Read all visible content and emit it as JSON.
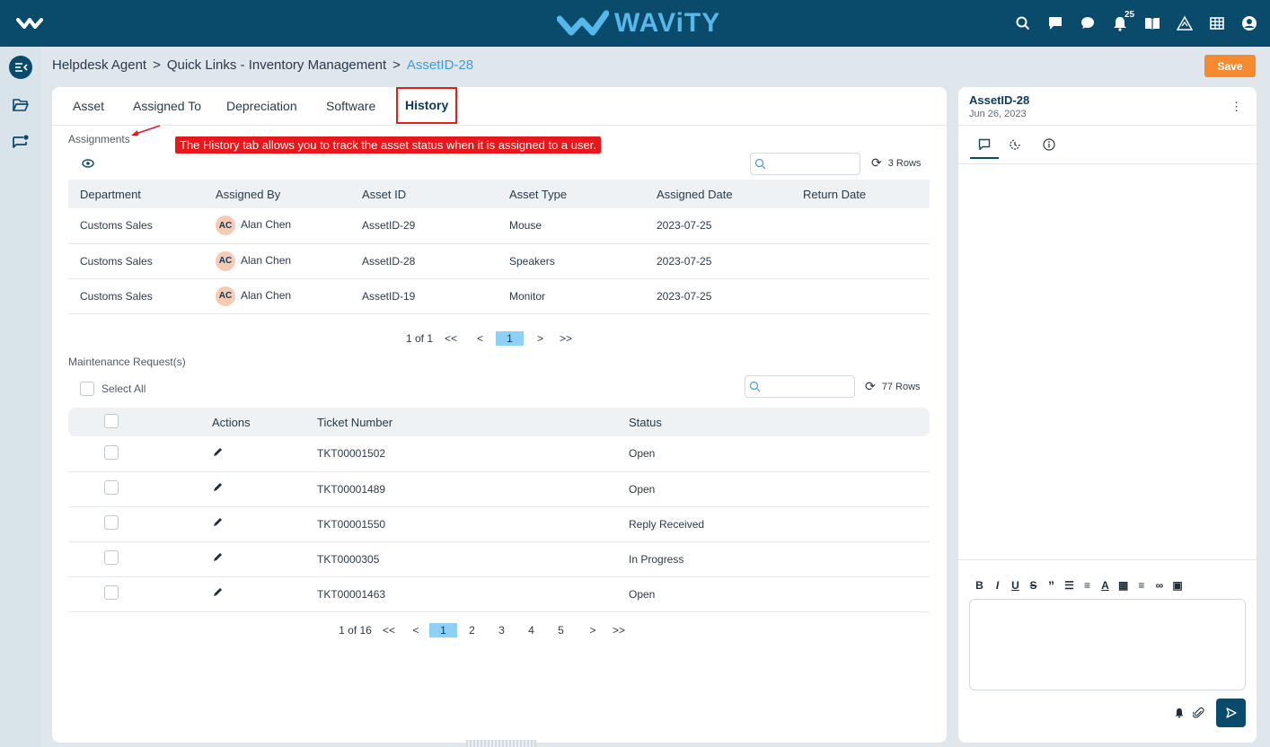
{
  "topbar": {
    "brand": "WAViTY",
    "notification_count": "25"
  },
  "breadcrumb": {
    "items": [
      "Helpdesk Agent",
      "Quick Links - Inventory Management"
    ],
    "separator": ">",
    "current": "AssetID-28"
  },
  "actions": {
    "save_label": "Save"
  },
  "tabs": [
    "Asset",
    "Assigned To",
    "Depreciation",
    "Software",
    "History"
  ],
  "active_tab": "History",
  "annotation": "The History tab allows you to track the asset status when it is assigned to a user.",
  "assignments": {
    "label": "Assignments",
    "search_placeholder": "",
    "rows_label": "3 Rows",
    "columns": [
      "Department",
      "Assigned By",
      "Asset ID",
      "Asset Type",
      "Assigned Date",
      "Return Date"
    ],
    "rows": [
      {
        "department": "Customs Sales",
        "initials": "AC",
        "assigned_by": "Alan Chen",
        "asset_id": "AssetID-29",
        "asset_type": "Mouse",
        "assigned_date": "2023-07-25",
        "return_date": ""
      },
      {
        "department": "Customs Sales",
        "initials": "AC",
        "assigned_by": "Alan Chen",
        "asset_id": "AssetID-28",
        "asset_type": "Speakers",
        "assigned_date": "2023-07-25",
        "return_date": ""
      },
      {
        "department": "Customs Sales",
        "initials": "AC",
        "assigned_by": "Alan Chen",
        "asset_id": "AssetID-19",
        "asset_type": "Monitor",
        "assigned_date": "2023-07-25",
        "return_date": ""
      }
    ],
    "pager": {
      "summary": "1 of 1",
      "first": "<<",
      "prev": "<",
      "current": "1",
      "next": ">",
      "last": ">>"
    }
  },
  "maintenance": {
    "label": "Maintenance Request(s)",
    "select_all": "Select All",
    "search_placeholder": "",
    "rows_label": "77 Rows",
    "columns": [
      "Actions",
      "Ticket Number",
      "Status"
    ],
    "rows": [
      {
        "ticket": "TKT00001502",
        "status": "Open"
      },
      {
        "ticket": "TKT00001489",
        "status": "Open"
      },
      {
        "ticket": "TKT00001550",
        "status": "Reply Received"
      },
      {
        "ticket": "TKT0000305",
        "status": "In Progress"
      },
      {
        "ticket": "TKT00001463",
        "status": "Open"
      }
    ],
    "pager": {
      "summary": "1 of 16",
      "first": "<<",
      "prev": "<",
      "pages": [
        "1",
        "2",
        "3",
        "4",
        "5"
      ],
      "next": ">",
      "last": ">>"
    }
  },
  "side_panel": {
    "title": "AssetID-28",
    "date": "Jun 26, 2023",
    "toolbar": [
      "B",
      "I",
      "U",
      "S",
      "99",
      "ol",
      "ul",
      "A",
      "A",
      "align",
      "link",
      "image"
    ]
  },
  "colors": {
    "topbar": "#0a4a6b",
    "accent": "#54b8ea",
    "save": "#f58a2e",
    "annotation": "#e8171b",
    "status_open": "#2f8fd0",
    "status_reply": "#2ea86a",
    "status_progress": "#f07a26"
  }
}
